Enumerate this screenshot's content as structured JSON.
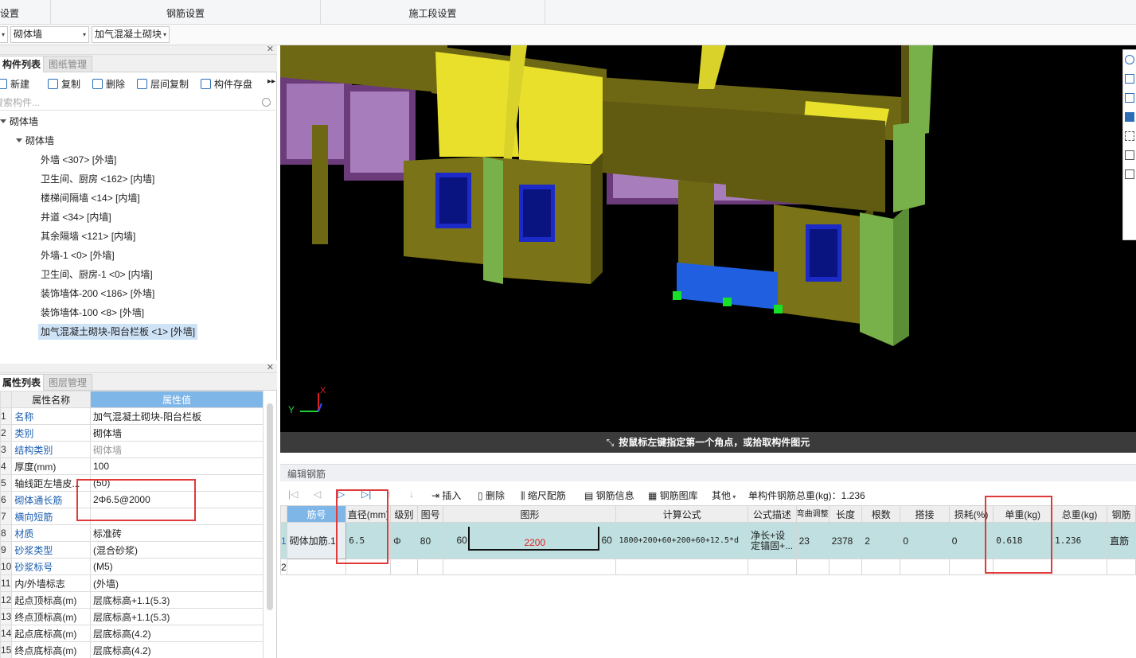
{
  "top_sections": [
    "设置",
    "钢筋设置",
    "施工段设置"
  ],
  "selectors": {
    "type": "砌体墙",
    "material": "加气混凝土砌块"
  },
  "component_panel": {
    "tabs": [
      "构件列表",
      "图纸管理"
    ],
    "toolbar": [
      "新建",
      "复制",
      "删除",
      "层间复制",
      "构件存盘"
    ],
    "search_placeholder": "搜索构件...",
    "root": "砌体墙",
    "group": "砌体墙",
    "items": [
      "外墙 <307> [外墙]",
      "卫生间、厨房 <162> [内墙]",
      "楼梯间隔墙 <14> [内墙]",
      "井道 <34> [内墙]",
      "其余隔墙 <121> [内墙]",
      "外墙-1 <0> [外墙]",
      "卫生间、厨房-1 <0> [内墙]",
      "装饰墙体-200 <186> [外墙]",
      "装饰墙体-100 <8> [外墙]",
      "加气混凝土砌块-阳台栏板 <1> [外墙]"
    ]
  },
  "property_panel": {
    "tabs": [
      "属性列表",
      "图层管理"
    ],
    "headers": [
      "属性名称",
      "属性值"
    ],
    "rows": [
      {
        "idx": "1",
        "name": "名称",
        "value": "加气混凝土砌块-阳台栏板"
      },
      {
        "idx": "2",
        "name": "类别",
        "value": "砌体墙"
      },
      {
        "idx": "3",
        "name": "结构类别",
        "value": "砌体墙"
      },
      {
        "idx": "4",
        "name": "厚度(mm)",
        "value": "100"
      },
      {
        "idx": "5",
        "name": "轴线距左墙皮...",
        "value": "(50)"
      },
      {
        "idx": "6",
        "name": "砌体通长筋",
        "value": "2Φ6.5@2000"
      },
      {
        "idx": "7",
        "name": "横向短筋",
        "value": ""
      },
      {
        "idx": "8",
        "name": "材质",
        "value": "标准砖"
      },
      {
        "idx": "9",
        "name": "砂浆类型",
        "value": "(混合砂浆)"
      },
      {
        "idx": "10",
        "name": "砂浆标号",
        "value": "(M5)"
      },
      {
        "idx": "11",
        "name": "内/外墙标志",
        "value": "(外墙)"
      },
      {
        "idx": "12",
        "name": "起点顶标高(m)",
        "value": "层底标高+1.1(5.3)"
      },
      {
        "idx": "13",
        "name": "终点顶标高(m)",
        "value": "层底标高+1.1(5.3)"
      },
      {
        "idx": "14",
        "name": "起点底标高(m)",
        "value": "层底标高(4.2)"
      },
      {
        "idx": "15",
        "name": "终点底标高(m)",
        "value": "层底标高(4.2)"
      }
    ]
  },
  "viewport": {
    "status": "按鼠标左键指定第一个角点，或拾取构件图元",
    "axis_y": "Y",
    "axis_x": "X"
  },
  "rebar_editor": {
    "title": "编辑钢筋",
    "toolbar": [
      "插入",
      "删除",
      "缩尺配筋",
      "钢筋信息",
      "钢筋图库",
      "其他"
    ],
    "total_weight": "单构件钢筋总重(kg)：1.236",
    "headers": [
      "筋号",
      "直径(mm)",
      "级别",
      "图号",
      "图形",
      "计算公式",
      "公式描述",
      "弯曲调整",
      "长度",
      "根数",
      "搭接",
      "损耗(%)",
      "单重(kg)",
      "总重(kg)",
      "钢筋"
    ],
    "row": {
      "idx": "1",
      "name": "砌体加筋.1",
      "diameter": "6.5",
      "grade": "Φ",
      "shape_no": "80",
      "shape_left": "60",
      "shape_mid": "2200",
      "shape_right": "60",
      "formula": "1800+200+60+200+60+12.5*d",
      "desc": "净长+设定锚固+...",
      "bend": "23",
      "length": "2378",
      "count": "2",
      "lap": "0",
      "loss": "0",
      "unit_weight": "0.618",
      "total_weight": "1.236",
      "type": "直筋"
    },
    "empty_row_idx": "2"
  },
  "colors": {
    "accent": "#7fb6e8",
    "highlight_box": "#e03a3a",
    "wall": "#7a7317",
    "parapet": "#f2ef2d",
    "selected_wall": "#1f5fe0",
    "column": "#77b24a"
  }
}
